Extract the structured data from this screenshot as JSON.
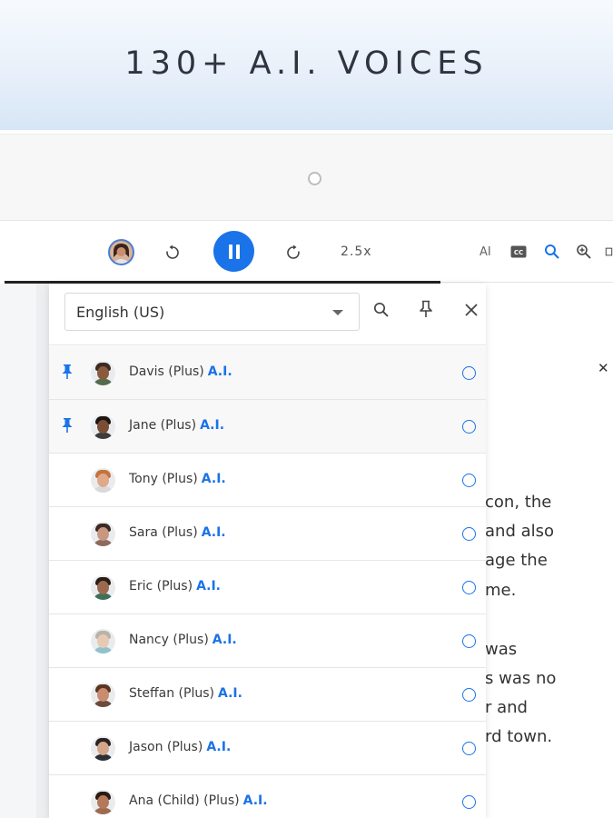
{
  "banner": {
    "title": "130+ A.I. VOICES"
  },
  "toolbar": {
    "speed": "2.5x",
    "ai_label": "AI",
    "accent": "#1a73e8"
  },
  "panel": {
    "language": "English (US)",
    "voices": [
      {
        "name": "Davis (Plus)",
        "tag": "A.I.",
        "pinned": true,
        "skin": "#8a5a3c",
        "hair": "#3b2a20",
        "shirt": "#556b4f"
      },
      {
        "name": "Jane (Plus)",
        "tag": "A.I.",
        "pinned": true,
        "skin": "#7a4d35",
        "hair": "#1e1410",
        "shirt": "#3c3c3c"
      },
      {
        "name": "Tony (Plus)",
        "tag": "A.I.",
        "pinned": false,
        "skin": "#e0a98a",
        "hair": "#c4733f",
        "shirt": "#d9d9d9"
      },
      {
        "name": "Sara (Plus)",
        "tag": "A.I.",
        "pinned": false,
        "skin": "#c99780",
        "hair": "#3b2a22",
        "shirt": "#8d6b5c"
      },
      {
        "name": "Eric (Plus)",
        "tag": "A.I.",
        "pinned": false,
        "skin": "#9b6a4e",
        "hair": "#2a1d16",
        "shirt": "#3f6f5a"
      },
      {
        "name": "Nancy (Plus)",
        "tag": "A.I.",
        "pinned": false,
        "skin": "#e7c9b4",
        "hair": "#b8b4a8",
        "shirt": "#8fc2cc"
      },
      {
        "name": "Steffan (Plus)",
        "tag": "A.I.",
        "pinned": false,
        "skin": "#c98c6e",
        "hair": "#5a3622",
        "shirt": "#6d4a3a"
      },
      {
        "name": "Jason (Plus)",
        "tag": "A.I.",
        "pinned": false,
        "skin": "#d4a689",
        "hair": "#2c2320",
        "shirt": "#2e2e35"
      },
      {
        "name": "Ana (Child) (Plus)",
        "tag": "A.I.",
        "pinned": false,
        "skin": "#b5795a",
        "hair": "#2a1a12",
        "shirt": "#9c6b50"
      }
    ]
  },
  "document": {
    "lines": [
      "con, the",
      "and also",
      "age the",
      "me.",
      "was",
      "s was no",
      "r and",
      "rd town."
    ]
  }
}
